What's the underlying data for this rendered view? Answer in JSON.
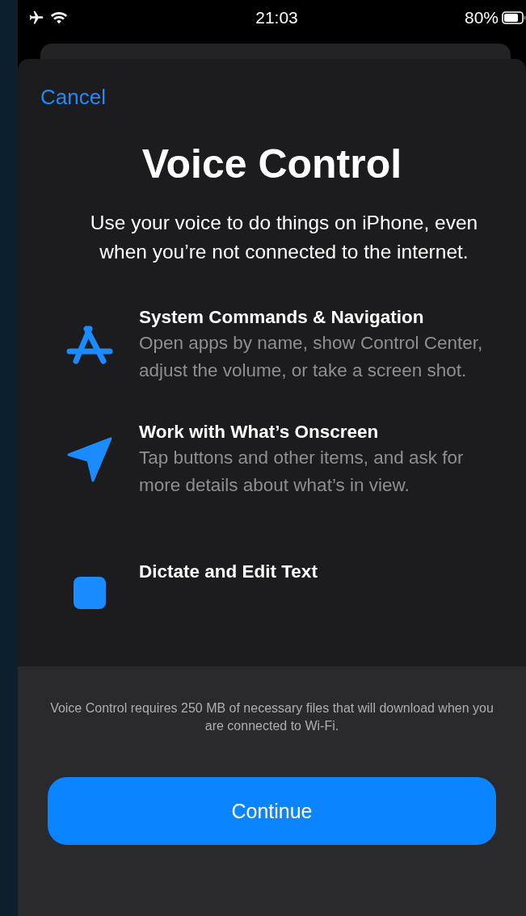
{
  "status_bar": {
    "time": "21:03",
    "battery": "80%"
  },
  "sheet": {
    "cancel": "Cancel",
    "title": "Voice Control",
    "description": "Use your voice to do things on iPhone, even when you’re not connected to the internet."
  },
  "features": [
    {
      "kind": "apps",
      "title": "System Commands & Navigation",
      "description": "Open apps by name, show Control Center, adjust the volume, or take a screen shot."
    },
    {
      "kind": "send",
      "title": "Work with What’s Onscreen",
      "description": "Tap buttons and other items, and ask for more details about what’s in view."
    },
    {
      "kind": "text",
      "title": "Dictate and Edit Text"
    }
  ],
  "footer": {
    "note": "Voice Control requires 250 MB of necessary files that will download when you are connected to Wi-Fi.",
    "button": "Continue"
  }
}
